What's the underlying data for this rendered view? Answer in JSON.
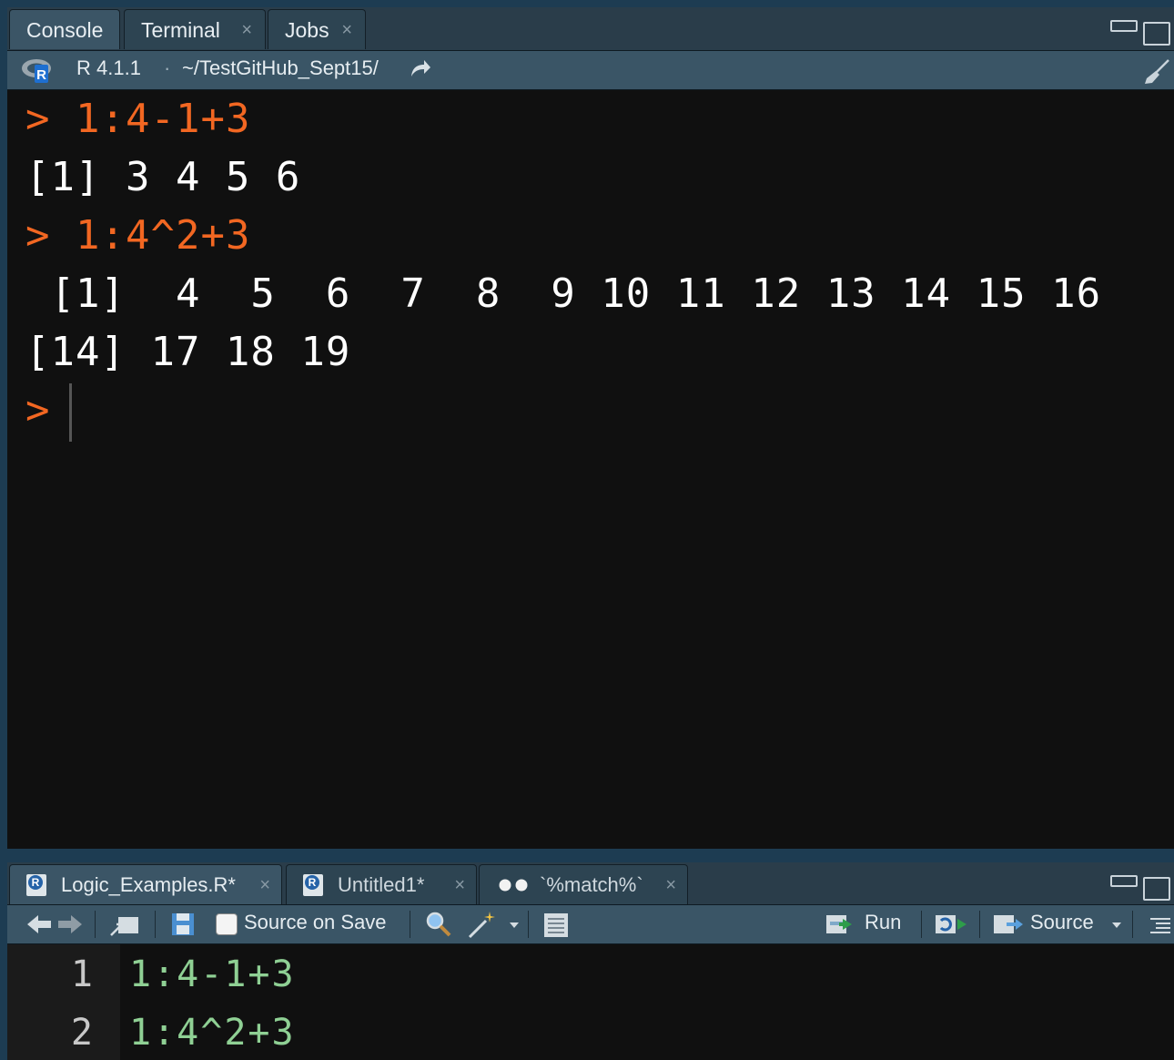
{
  "console_pane": {
    "tabs": [
      {
        "label": "Console",
        "closable": false,
        "active": true
      },
      {
        "label": "Terminal",
        "closable": true,
        "active": false
      },
      {
        "label": "Jobs",
        "closable": true,
        "active": false
      }
    ],
    "close_glyph": "×",
    "r_version": "R 4.1.1",
    "separator": "·",
    "working_dir": "~/TestGitHub_Sept15/",
    "lines": [
      {
        "kind": "command",
        "prompt": ">",
        "text": "1:4-1+3"
      },
      {
        "kind": "output",
        "text": "[1] 3 4 5 6"
      },
      {
        "kind": "command",
        "prompt": ">",
        "text": "1:4^2+3"
      },
      {
        "kind": "output",
        "text": " [1]  4  5  6  7  8  9 10 11 12 13 14 15 16"
      },
      {
        "kind": "output",
        "text": "[14] 17 18 19"
      },
      {
        "kind": "prompt",
        "prompt": ">"
      }
    ],
    "colors": {
      "command": "#f26722",
      "output": "#ffffff",
      "background": "#101010"
    }
  },
  "editor_pane": {
    "tabs": [
      {
        "label": "Logic_Examples.R*",
        "icon": "r-file-icon",
        "active": true
      },
      {
        "label": "Untitled1*",
        "icon": "r-file-icon",
        "active": false
      },
      {
        "label": "`%match%`",
        "icon": "function-dots-icon",
        "active": false
      }
    ],
    "toolbar": {
      "source_on_save_label": "Source on Save",
      "run_label": "Run",
      "source_label": "Source"
    },
    "lines": [
      {
        "number": "1",
        "code": "1:4-1+3"
      },
      {
        "number": "2",
        "code": "1:4^2+3"
      }
    ],
    "colors": {
      "code": "#8fd094"
    }
  }
}
